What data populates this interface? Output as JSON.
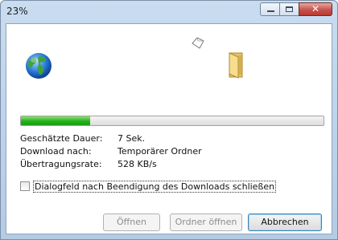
{
  "window": {
    "title": "23%"
  },
  "caption": {
    "close_glyph": "✕"
  },
  "icons": {
    "globe": "globe-icon",
    "paper": "flying-paper-icon",
    "folder": "folder-icon"
  },
  "progress": {
    "percent": 23,
    "color": "#22b21b"
  },
  "info": {
    "duration_label": "Geschätzte Dauer:",
    "duration_value": "7 Sek.",
    "target_label": "Download nach:",
    "target_value": "Temporärer Ordner",
    "rate_label": "Übertragungsrate:",
    "rate_value": "528 KB/s"
  },
  "checkbox": {
    "label": "Dialogfeld nach Beendigung des Downloads schließen",
    "checked": false
  },
  "buttons": {
    "open": "Öffnen",
    "open_folder": "Ordner öffnen",
    "cancel": "Abbrechen"
  }
}
